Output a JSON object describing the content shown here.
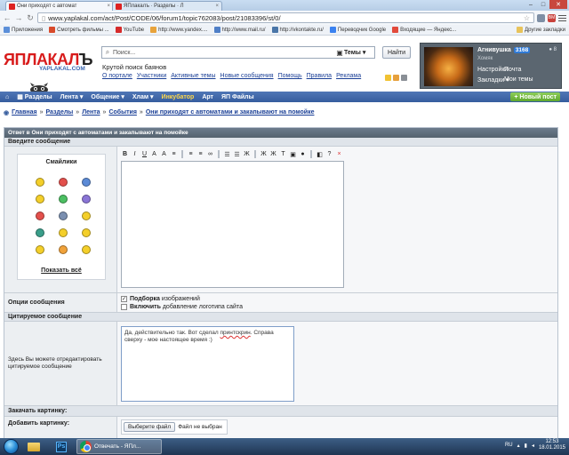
{
  "browser": {
    "tabs": [
      {
        "label": "Они приходят с автомат",
        "active": true
      },
      {
        "label": "ЯПлакалъ · Разделы · Л",
        "active": false
      }
    ],
    "url": "www.yaplakal.com/act/Post/CODE/06/forum1/topic762083/post/21083396/st/0/",
    "ext_badge": "BM",
    "bookmarks": [
      {
        "label": "Приложения",
        "color": "#5b8fd9"
      },
      {
        "label": "Смотреть фильмы ...",
        "color": "#d84a2b"
      },
      {
        "label": "YouTube",
        "color": "#d62b2b"
      },
      {
        "label": "http://www.yandex....",
        "color": "#e8a33b"
      },
      {
        "label": "http://www.mail.ru/",
        "color": "#4f7fc7"
      },
      {
        "label": "http://vkontakte.ru/",
        "color": "#4a76a8"
      },
      {
        "label": "Переводчик Google",
        "color": "#3b82f0"
      },
      {
        "label": "Входящие — Яндекс...",
        "color": "#e24a3b"
      }
    ],
    "other_bookmarks": "Другие закладки"
  },
  "site": {
    "logo_text_red": "ЯПЛАКАЛ",
    "logo_text_dark": "Ъ",
    "logo_sub": "YAPLAKAL.COM",
    "search_placeholder": "Поиск...",
    "search_scope": "Темы",
    "search_button": "Найти",
    "slogan": "Крутой поиск баянов",
    "top_links": [
      "О портале",
      "Участники",
      "Активные темы",
      "Новые сообщения",
      "Помощь",
      "Правила",
      "Реклама"
    ],
    "user": {
      "name": "Агнивушка",
      "karma": "3168",
      "status": "Хомяк",
      "count": "8",
      "links": [
        "Настройки",
        "Почта",
        "Закладки",
        "Мои темы"
      ]
    },
    "nav": [
      "Разделы",
      "Лента",
      "Общение",
      "Хлам",
      "Инкубатор",
      "Арт",
      "ЯП Файлы"
    ],
    "new_post": "Новый пост",
    "breadcrumbs": [
      "Главная",
      "Разделы",
      "Лента",
      "События",
      "Они приходят с автоматами и закапывают на помойке"
    ]
  },
  "form": {
    "header": "Ответ в Они приходят с автоматами и закапывают на помойке",
    "enter_message": "Введите сообщение",
    "smilies_title": "Смайлики",
    "smilies": [
      {
        "name": "smile",
        "color": "#f4cf2a"
      },
      {
        "name": "angry",
        "color": "#e3504c"
      },
      {
        "name": "cool",
        "color": "#5b8ad6"
      },
      {
        "name": "wink",
        "color": "#f4cf2a"
      },
      {
        "name": "tongue",
        "color": "#4cbf62"
      },
      {
        "name": "sad",
        "color": "#8a75d6"
      },
      {
        "name": "gun",
        "color": "#e3504c"
      },
      {
        "name": "hat",
        "color": "#7a8fb0"
      },
      {
        "name": "drink",
        "color": "#f4cf2a"
      },
      {
        "name": "ninja",
        "color": "#3a9e8a"
      },
      {
        "name": "dance",
        "color": "#f4cf2a"
      },
      {
        "name": "glasses",
        "color": "#f4cf2a"
      },
      {
        "name": "crazy",
        "color": "#f4cf2a"
      },
      {
        "name": "laugh",
        "color": "#f0a23a"
      },
      {
        "name": "pointer",
        "color": "#f4cf2a"
      }
    ],
    "show_all": "Показать всё",
    "toolbar": [
      "B",
      "I",
      "U",
      "A",
      "A",
      "≡",
      "≡",
      "≡",
      "∞",
      "☰",
      "☰",
      "Ж",
      "Ж",
      "Ж",
      "T",
      "▣",
      "●",
      "◧",
      "?",
      "×"
    ],
    "options_label": "Опции сообщения",
    "option1_bold": "Подборка",
    "option1_rest": " изображений",
    "option1_checked": true,
    "option2_bold": "Включить",
    "option2_rest": " добавление логотипа сайта",
    "option2_checked": false,
    "quote_section": "Цитируемое сообщение",
    "quote_label": "Здесь Вы можете отредактировать цитируемое сообщение",
    "quote_text_1": "Да, действительно так. Вот сделал ",
    "quote_text_misspelled": "принтскрин",
    "quote_text_2": ". Справа сверху - мое настоящее время :)",
    "attach_section": "Закачать картинку:",
    "attach_label": "Добавить картинку:",
    "file_button": "Выберите файл",
    "file_status": "Файл не выбран"
  },
  "taskbar": {
    "apps": [
      "explorer",
      "photoshop",
      "chrome"
    ],
    "chrome_label": "Отвечать - ЯПл...",
    "lang": "RU",
    "time": "12:53",
    "date": "18.01.2015"
  }
}
